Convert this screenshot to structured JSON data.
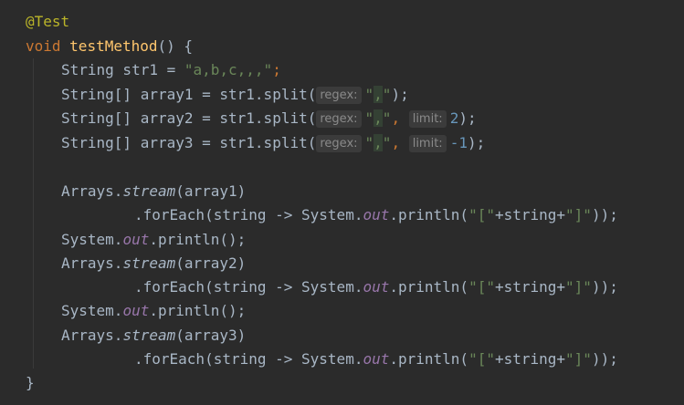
{
  "code": {
    "annotation": "@Test",
    "kw_void": "void",
    "method_name": "testMethod",
    "method_sig_rest": "() {",
    "line_str1": {
      "decl": "String str1 = ",
      "value": "\"a,b,c,,,\"",
      "end": ";"
    },
    "line_array1": {
      "decl": "String[] array1 = str1.split(",
      "hint_regex": "regex:",
      "q1": "\"",
      "sep": ",",
      "q2": "\"",
      "end": ");"
    },
    "line_array2": {
      "decl": "String[] array2 = str1.split(",
      "hint_regex": "regex:",
      "q1": "\"",
      "sep": ",",
      "q2": "\"",
      "comma": ", ",
      "hint_limit": "limit:",
      "limit": "2",
      "end": ");"
    },
    "line_array3": {
      "decl": "String[] array3 = str1.split(",
      "hint_regex": "regex:",
      "q1": "\"",
      "sep": ",",
      "q2": "\"",
      "comma": ", ",
      "hint_limit": "limit:",
      "limit": "-1",
      "end": ");"
    },
    "arrays_prefix": "Arrays.",
    "stream_method": "stream",
    "stream_arg1": "(array1)",
    "stream_arg2": "(array2)",
    "stream_arg3": "(array3)",
    "foreach_prefix": ".forEach(string -> System.",
    "out_field": "out",
    "println_call": ".println(",
    "str_open": "\"[\"",
    "concat": "+string+",
    "str_close": "\"]\"",
    "foreach_end": "));",
    "system_prefix": "System.",
    "println_empty": ".println();",
    "close_brace": "}"
  }
}
